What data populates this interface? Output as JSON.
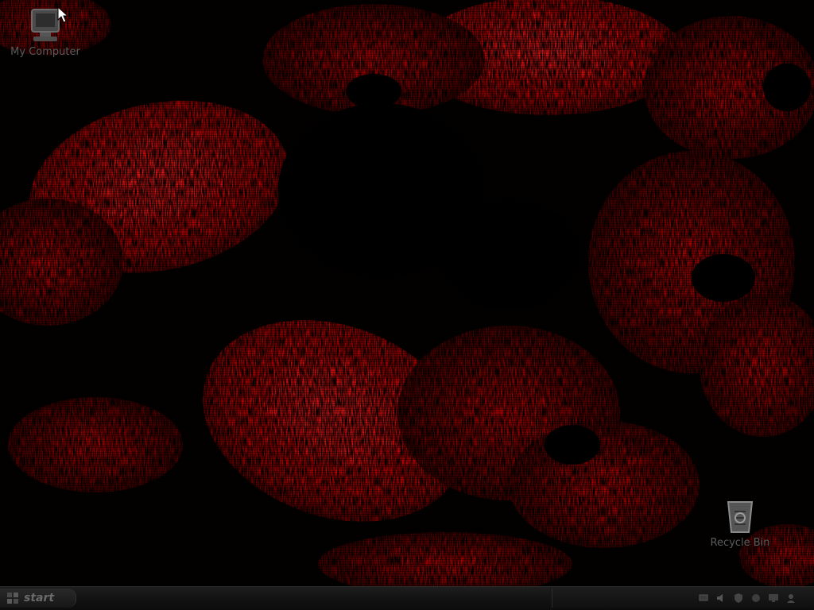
{
  "desktop": {
    "icons": [
      {
        "label": "My Computer",
        "icon": "computer-icon"
      },
      {
        "label": "Recycle Bin",
        "icon": "recycle-bin-icon"
      }
    ]
  },
  "taskbar": {
    "start_label": "start",
    "tray_icons": [
      "network-icon",
      "volume-icon",
      "security-icon",
      "speaker-icon",
      "display-icon",
      "user-icon"
    ],
    "clock": ""
  },
  "colors": {
    "wallpaper_accent": "#d10000",
    "wallpaper_dark": "#1a0000",
    "taskbar": "#141414",
    "label_gray": "#5c5c5c"
  }
}
